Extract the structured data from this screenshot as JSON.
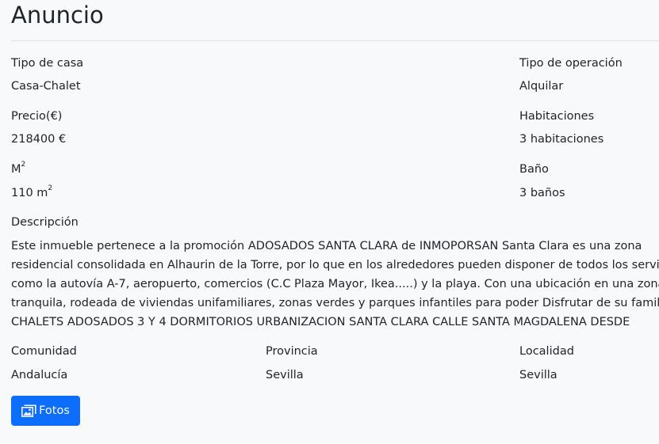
{
  "page_title": "Anuncio",
  "fields": {
    "tipo_casa": {
      "label": "Tipo de casa",
      "value": "Casa-Chalet"
    },
    "tipo_operacion": {
      "label": "Tipo de operación",
      "value": "Alquilar"
    },
    "precio": {
      "label": "Precio(€)",
      "value": "218400 €"
    },
    "habitaciones": {
      "label": "Habitaciones",
      "value": "3 habitaciones"
    },
    "m2": {
      "label": "M",
      "label_sup": "2",
      "value": "110 m",
      "value_sup": "2"
    },
    "bano": {
      "label": "Baño",
      "value": "3 baños"
    },
    "comunidad": {
      "label": "Comunidad",
      "value": "Andalucía"
    },
    "provincia": {
      "label": "Provincia",
      "value": "Sevilla"
    },
    "localidad": {
      "label": "Localidad",
      "value": "Sevilla"
    }
  },
  "descripcion": {
    "label": "Descripción",
    "lines": [
      "Este inmueble pertenece a la promoción ADOSADOS SANTA CLARA de INMOPORSAN Santa Clara es una zona",
      "residencial consolidada en Alhaurin de la Torre, por lo que en los alrededores pueden disponer de todos los servicios,",
      "como la autovía A-7, aeropuerto, comercios (C.C Plaza Mayor, Ikea.....) y la playa. Con una ubicación en una zona",
      "tranquila, rodeada de viviendas unifamiliares, zonas verdes y parques infantiles para poder Disfrutar de su familia.",
      "CHALETS ADOSADOS 3 Y 4 DORMITORIOS URBANIZACION SANTA CLARA CALLE SANTA MAGDALENA DESDE"
    ]
  },
  "fotos_button": {
    "label": "Fotos",
    "icon": "images-icon",
    "color": "#0d6efd"
  }
}
